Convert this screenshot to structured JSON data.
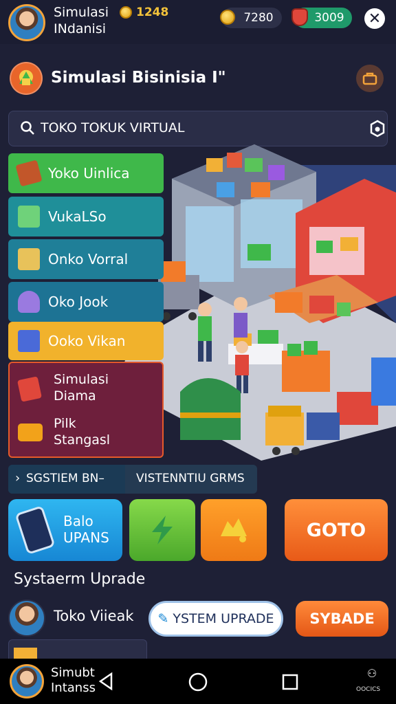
{
  "topbar": {
    "title_line1": "Simulasi",
    "title_line2": "INdanisi",
    "badge_value": "1248",
    "coins": "7280",
    "gems": "3009"
  },
  "header": {
    "title": "Simulasi Bisinisia I\""
  },
  "search": {
    "placeholder": "TOKO TOKUK VIRTUAL"
  },
  "menu": {
    "items": [
      {
        "label": "Yoko Uinlica",
        "color": "#3fb84a"
      },
      {
        "label": "VukaLSo",
        "color": "#1f8f99"
      },
      {
        "label": "Onko Vorral",
        "color": "#1f7f98"
      },
      {
        "label": "Oko Jook",
        "color": "#1d7394"
      },
      {
        "label": "Ooko Vikan",
        "color": "#f1b22c"
      }
    ],
    "subitems": [
      {
        "line1": "Simulasi",
        "line2": "Diama"
      },
      {
        "line1": "Pilk",
        "line2": "Stangasl"
      }
    ]
  },
  "section": {
    "title": "SGSTIEM BN–",
    "subtitle": "VISTENNTIU GRMS"
  },
  "actions": {
    "blue_line1": "Balo",
    "blue_line2": "UPANS",
    "goto_label": "GOTO"
  },
  "upgrade": {
    "caption": "Systaerm Uprade",
    "row_label": "Toko Viieak",
    "white_button": "YSTEM UPRADE",
    "orange_button": "SYBADE"
  },
  "navbar": {
    "line1": "Simubt",
    "line2": "Intanss",
    "right_label": "OOCICS"
  },
  "colors": {
    "background": "#1e2036",
    "accent_orange": "#f47b25",
    "accent_green": "#3fb84a",
    "accent_blue": "#1fa7e8"
  }
}
